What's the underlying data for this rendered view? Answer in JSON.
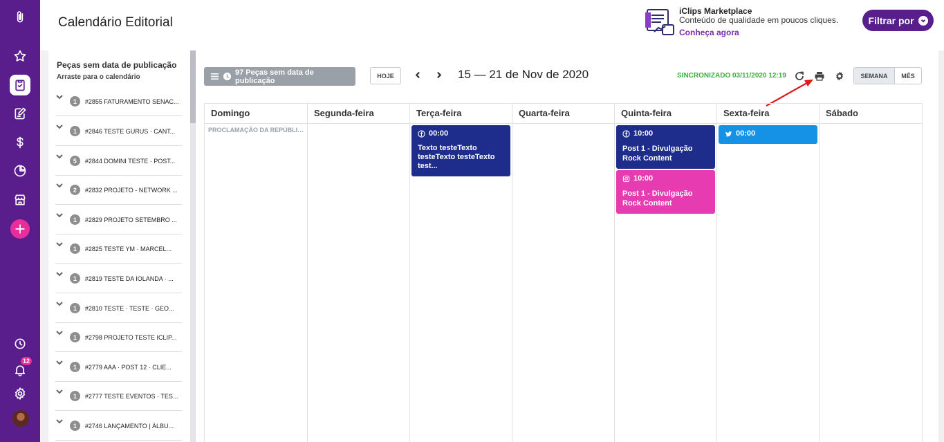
{
  "header": {
    "title": "Calendário Editorial",
    "marketplace": {
      "title": "iClips Marketplace",
      "subtitle": "Conteúdo de qualidade em poucos cliques.",
      "link": "Conheça agora"
    },
    "filter_button": "Filtrar por"
  },
  "nav": {
    "notification_count": "12"
  },
  "panel": {
    "title": "Peças sem data de publicação",
    "subtitle": "Arraste para o calendário",
    "items": [
      {
        "count": "1",
        "text": "#2855 FATURAMENTO SENAC..."
      },
      {
        "count": "1",
        "text": "#2846 TESTE GURUS · CANT..."
      },
      {
        "count": "5",
        "text": "#2844 DOMINI TESTE · POST..."
      },
      {
        "count": "2",
        "text": "#2832 PROJETO - NETWORK ..."
      },
      {
        "count": "1",
        "text": "#2829 PROJETO SETEMBRO ..."
      },
      {
        "count": "1",
        "text": "#2825 TESTE YM · MARCEL..."
      },
      {
        "count": "1",
        "text": "#2819 TESTE DA IOLANDA · ..."
      },
      {
        "count": "1",
        "text": "#2810 TESTE · TESTE · GEO..."
      },
      {
        "count": "1",
        "text": "#2798 PROJETO TESTE ICLIP..."
      },
      {
        "count": "1",
        "text": "#2779 AAA · POST 12 · CLIE..."
      },
      {
        "count": "1",
        "text": "#2777 TESTE EVENTOS · TES..."
      },
      {
        "count": "1",
        "text": "#2746 LANÇAMENTO | ÁLBU..."
      }
    ]
  },
  "toolbar": {
    "unscheduled_button": "97 Peças sem data de publicação",
    "today_button": "HOJE",
    "date_range": "15 — 21 de Nov de 2020",
    "sync_status": "SINCRONIZADO 03/11/2020 12:19",
    "view_week": "SEMANA",
    "view_month": "MÊS"
  },
  "calendar": {
    "days": [
      "Domingo",
      "Segunda-feira",
      "Terça-feira",
      "Quarta-feira",
      "Quinta-feira",
      "Sexta-feira",
      "Sábado"
    ],
    "holiday": "PROCLAMAÇÃO DA REPÚBLICA",
    "events": {
      "tuesday_fb": {
        "time": "00:00",
        "network": "facebook-icon",
        "body": "Texto testeTexto testeTexto testeTexto test..."
      },
      "thursday_fb": {
        "time": "10:00",
        "network": "facebook-icon",
        "title": "Post 1 - Divulgação Rock Content"
      },
      "thursday_ig": {
        "time": "10:00",
        "network": "instagram-icon",
        "title": "Post 1 - Divulgação Rock Content"
      },
      "friday_tw": {
        "time": "00:00",
        "network": "twitter-icon"
      }
    }
  },
  "colors": {
    "nav": "#5a1e8c",
    "accent_pink": "#e92d9a",
    "event_navy": "#1e2d8c",
    "event_pink": "#e73bb1",
    "event_blue": "#1592e6",
    "sync_green": "#3cae3c"
  }
}
